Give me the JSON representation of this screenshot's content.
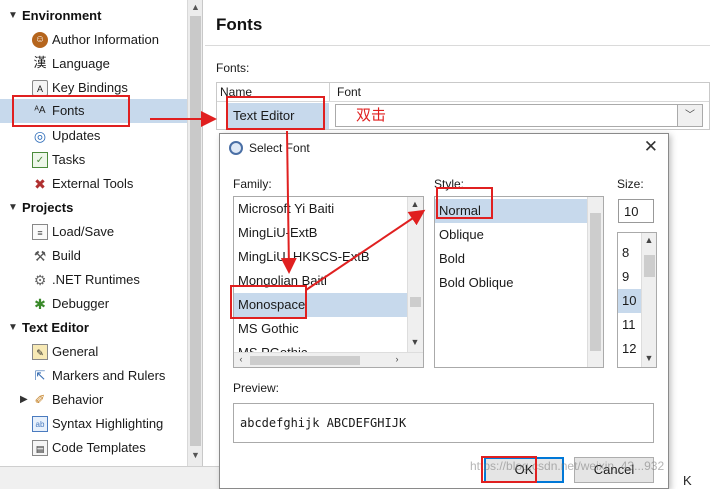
{
  "tree": {
    "items": [
      {
        "type": "category",
        "label": "Environment",
        "expanded": true
      },
      {
        "type": "item",
        "label": "Author Information",
        "icon": "author-icon"
      },
      {
        "type": "item",
        "label": "Language",
        "icon": "language-icon",
        "glyph": "漢"
      },
      {
        "type": "item",
        "label": "Key Bindings",
        "icon": "key-bindings-icon"
      },
      {
        "type": "item",
        "label": "Fonts",
        "icon": "fonts-icon",
        "glyph": "ᴬA",
        "selected": true
      },
      {
        "type": "item",
        "label": "Updates",
        "icon": "updates-icon"
      },
      {
        "type": "item",
        "label": "Tasks",
        "icon": "tasks-icon"
      },
      {
        "type": "item",
        "label": "External Tools",
        "icon": "external-tools-icon"
      },
      {
        "type": "category",
        "label": "Projects",
        "expanded": true
      },
      {
        "type": "item",
        "label": "Load/Save",
        "icon": "load-save-icon"
      },
      {
        "type": "item",
        "label": "Build",
        "icon": "build-icon"
      },
      {
        "type": "item",
        "label": ".NET Runtimes",
        "icon": "net-runtimes-icon"
      },
      {
        "type": "item",
        "label": "Debugger",
        "icon": "debugger-icon"
      },
      {
        "type": "category",
        "label": "Text Editor",
        "expanded": true
      },
      {
        "type": "item",
        "label": "General",
        "icon": "general-icon"
      },
      {
        "type": "item",
        "label": "Markers and Rulers",
        "icon": "markers-icon"
      },
      {
        "type": "item",
        "label": "Behavior",
        "icon": "behavior-icon",
        "collapsed": true
      },
      {
        "type": "item",
        "label": "Syntax Highlighting",
        "icon": "syntax-highlighting-icon"
      },
      {
        "type": "item",
        "label": "Code Templates",
        "icon": "code-templates-icon"
      }
    ]
  },
  "panel": {
    "title": "Fonts",
    "fonts_label": "Fonts:",
    "columns": [
      "Name",
      "Font"
    ],
    "row": {
      "name": "Text Editor",
      "font": ""
    }
  },
  "annotation_text": "双击",
  "dialog": {
    "title": "Select Font",
    "family_label": "Family:",
    "style_label": "Style:",
    "size_label": "Size:",
    "families": [
      "Microsoft Yi Baiti",
      "MingLiU-ExtB",
      "MingLiU_HKSCS-ExtB",
      "Mongolian Baiti",
      "Monospace",
      "MS Gothic",
      "MS PGothic"
    ],
    "selected_family": "Monospace",
    "styles": [
      "Normal",
      "Oblique",
      "Bold",
      "Bold Oblique"
    ],
    "selected_style": "Normal",
    "size_value": "10",
    "sizes": [
      "8",
      "9",
      "10",
      "11",
      "12"
    ],
    "selected_size": "10",
    "preview_label": "Preview:",
    "preview_text": "abcdefghijk ABCDEFGHIJK",
    "ok_label": "OK",
    "cancel_label": "Cancel"
  },
  "status_char": "K",
  "watermark": "https://blog.csdn.net/weixin_43...932",
  "colors": {
    "selection": "#c7d9ec",
    "annotation": "#e02020",
    "ok_border": "#0078d7"
  }
}
